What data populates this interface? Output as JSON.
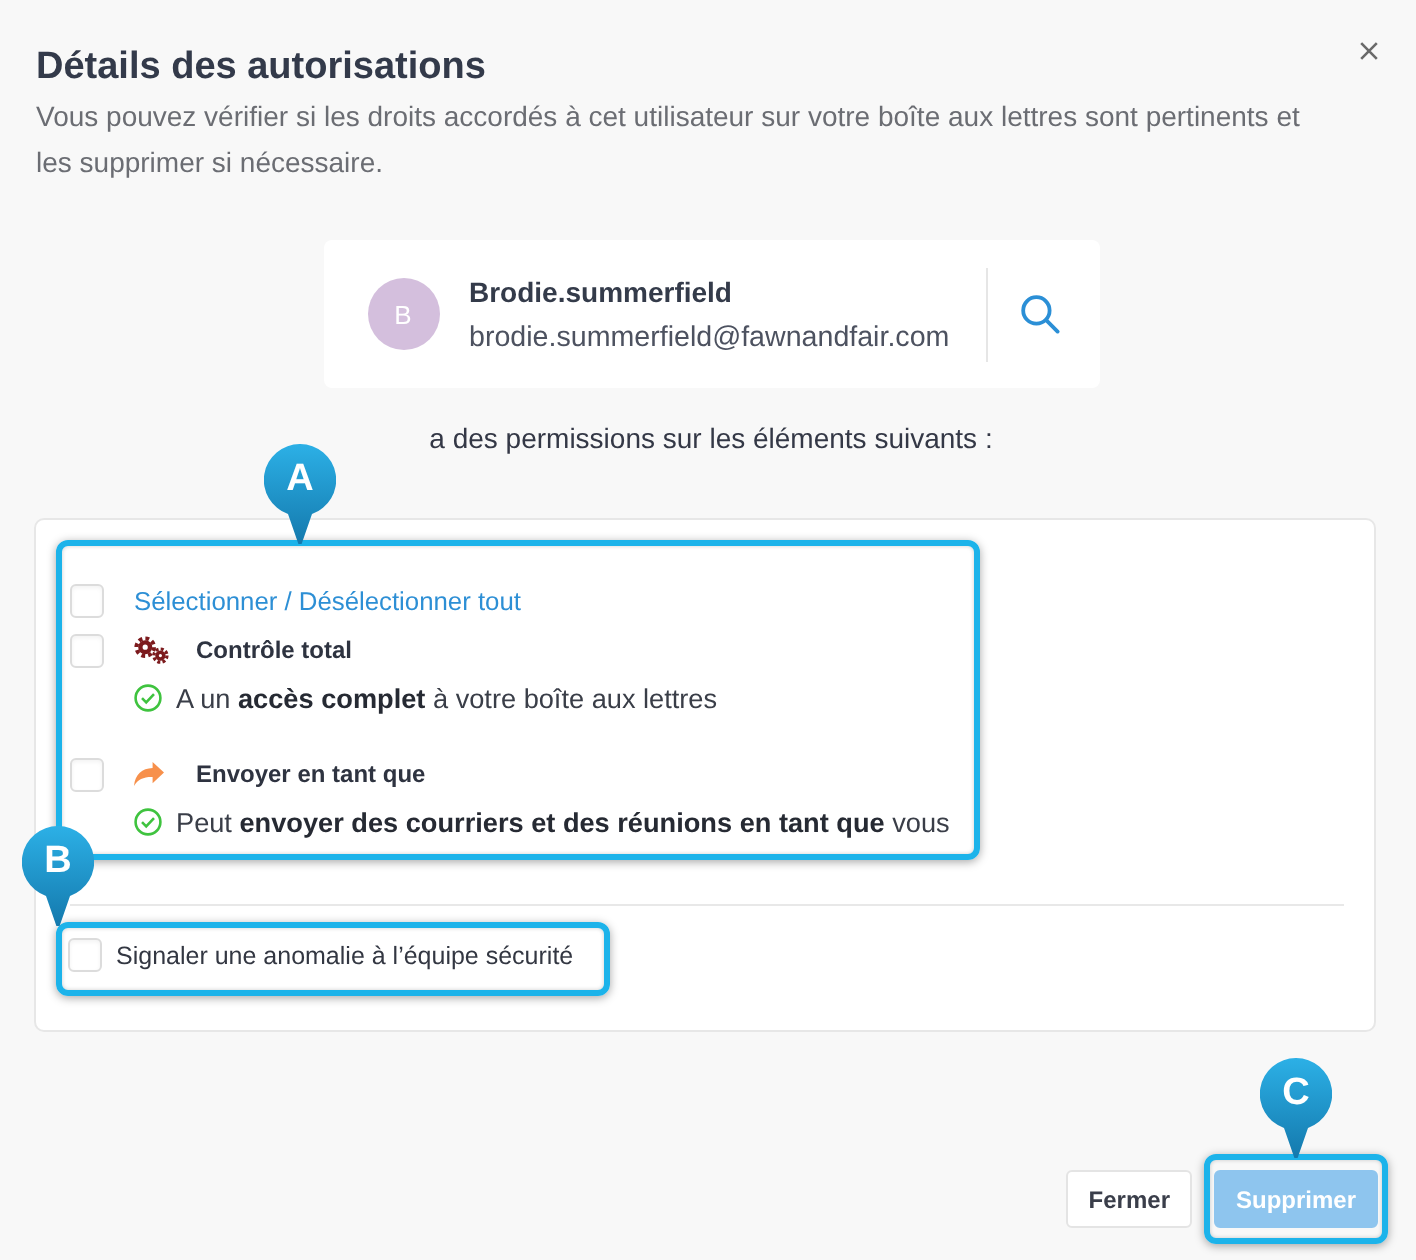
{
  "dialog": {
    "title": "Détails des autorisations",
    "description": "Vous pouvez vérifier si les droits accordés à cet utilisateur sur votre boîte aux lettres sont pertinents et les supprimer si nécessaire."
  },
  "user": {
    "avatar_initial": "B",
    "name": "Brodie.summerfield",
    "email": "brodie.summerfield@fawnandfair.com"
  },
  "permissions_intro": "a des permissions sur les éléments suivants :",
  "permissions": {
    "callout": "A",
    "select_all": {
      "label": "Sélectionner / Désélectionner tout",
      "checked": false
    },
    "items": [
      {
        "kind": "gears",
        "name": "Contrôle total",
        "checked": false,
        "description": "A un **accès complet** à votre boîte aux lettres"
      },
      {
        "kind": "send",
        "name": "Envoyer en tant que",
        "checked": false,
        "description": "Peut **envoyer des courriers et des réunions en tant que** vous"
      }
    ]
  },
  "report": {
    "callout": "B",
    "label": "Signaler une anomalie à l’équipe sécurité",
    "checked": false
  },
  "buttons": [
    {
      "kind": "secondary",
      "label": "Fermer",
      "disabled": false
    },
    {
      "kind": "primary",
      "label": "Supprimer",
      "disabled": true,
      "callout": "C"
    }
  ]
}
